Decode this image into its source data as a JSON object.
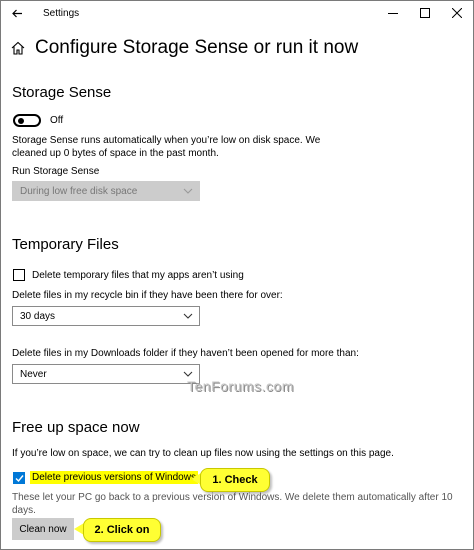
{
  "titlebar": {
    "title": "Settings"
  },
  "page": {
    "title": "Configure Storage Sense or run it now"
  },
  "storage_sense": {
    "heading": "Storage Sense",
    "toggle_state": "Off",
    "description_line1": "Storage Sense runs automatically when you’re low on disk space. We",
    "description_line2": "cleaned up 0 bytes of space in the past month.",
    "run_label": "Run Storage Sense",
    "run_value": "During low free disk space"
  },
  "temporary_files": {
    "heading": "Temporary Files",
    "delete_temp_label": "Delete temporary files that my apps aren’t using",
    "recycle_label": "Delete files in my recycle bin if they have been there for over:",
    "recycle_value": "30 days",
    "downloads_label": "Delete files in my Downloads folder if they haven’t been opened for more than:",
    "downloads_value": "Never"
  },
  "free_up": {
    "heading": "Free up space now",
    "intro": "If you’re low on space, we can try to clean up files now using the settings on this page.",
    "delete_prev_label": "Delete previous versions of Windows",
    "delete_prev_desc": "These let your PC go back to a previous version of Windows. We delete them automatically after 10 days.",
    "clean_button": "Clean now"
  },
  "annotations": {
    "callout1": "1. Check",
    "callout2": "2. Click on",
    "watermark": "TenForums.com"
  },
  "colors": {
    "accent": "#0078d7",
    "highlight": "#ffff00",
    "callout": "#ffff33"
  }
}
